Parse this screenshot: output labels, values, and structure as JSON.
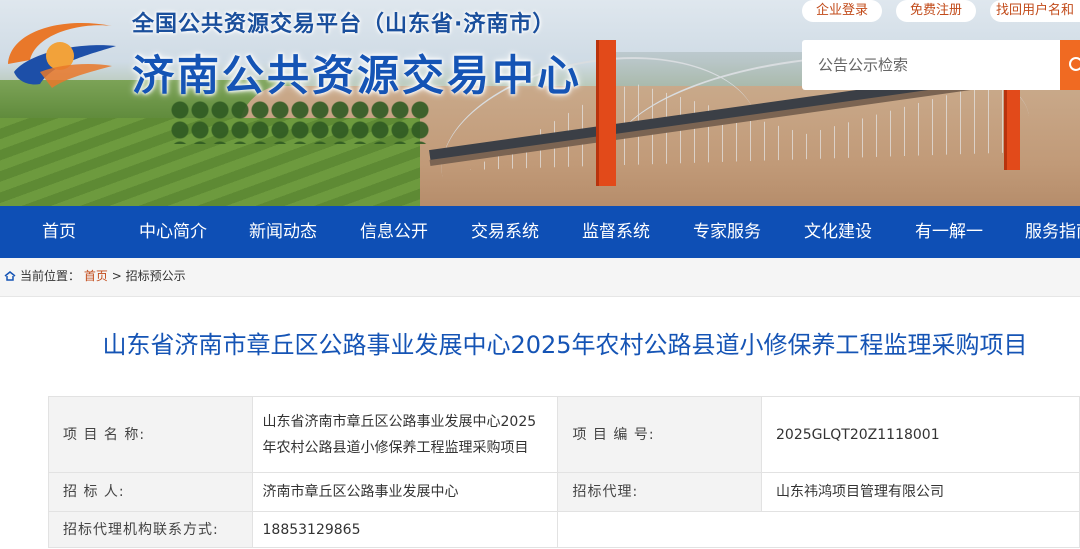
{
  "header": {
    "subtitle": "全国公共资源交易平台（山东省·济南市）",
    "title": "济南公共资源交易中心",
    "links": [
      "企业登录",
      "免费注册",
      "找回用户名和"
    ],
    "search": {
      "placeholder": "公告公示检索"
    },
    "colors": {
      "brand_blue": "#1554b5",
      "accent_orange": "#f06a22"
    }
  },
  "nav": {
    "items": [
      "首页",
      "中心简介",
      "新闻动态",
      "信息公开",
      "交易系统",
      "监督系统",
      "专家服务",
      "文化建设",
      "有一解一",
      "服务指南"
    ]
  },
  "breadcrumb": {
    "prefix": "当前位置：",
    "home": "首页",
    "separator": " >",
    "current": "招标预公示"
  },
  "main": {
    "title": "山东省济南市章丘区公路事业发展中心2025年农村公路县道小修保养工程监理采购项目",
    "rows": [
      {
        "label1": "项 目 名 称:",
        "value1": "山东省济南市章丘区公路事业发展中心2025年农村公路县道小修保养工程监理采购项目",
        "label2": "项 目 编 号:",
        "value2": "2025GLQT20Z1118001"
      },
      {
        "label1": "招 标 人:",
        "value1": "济南市章丘区公路事业发展中心",
        "label2": "招标代理:",
        "value2": "山东祎鸿项目管理有限公司"
      },
      {
        "label1": "招标代理机构联系方式:",
        "value1": "18853129865"
      }
    ]
  }
}
